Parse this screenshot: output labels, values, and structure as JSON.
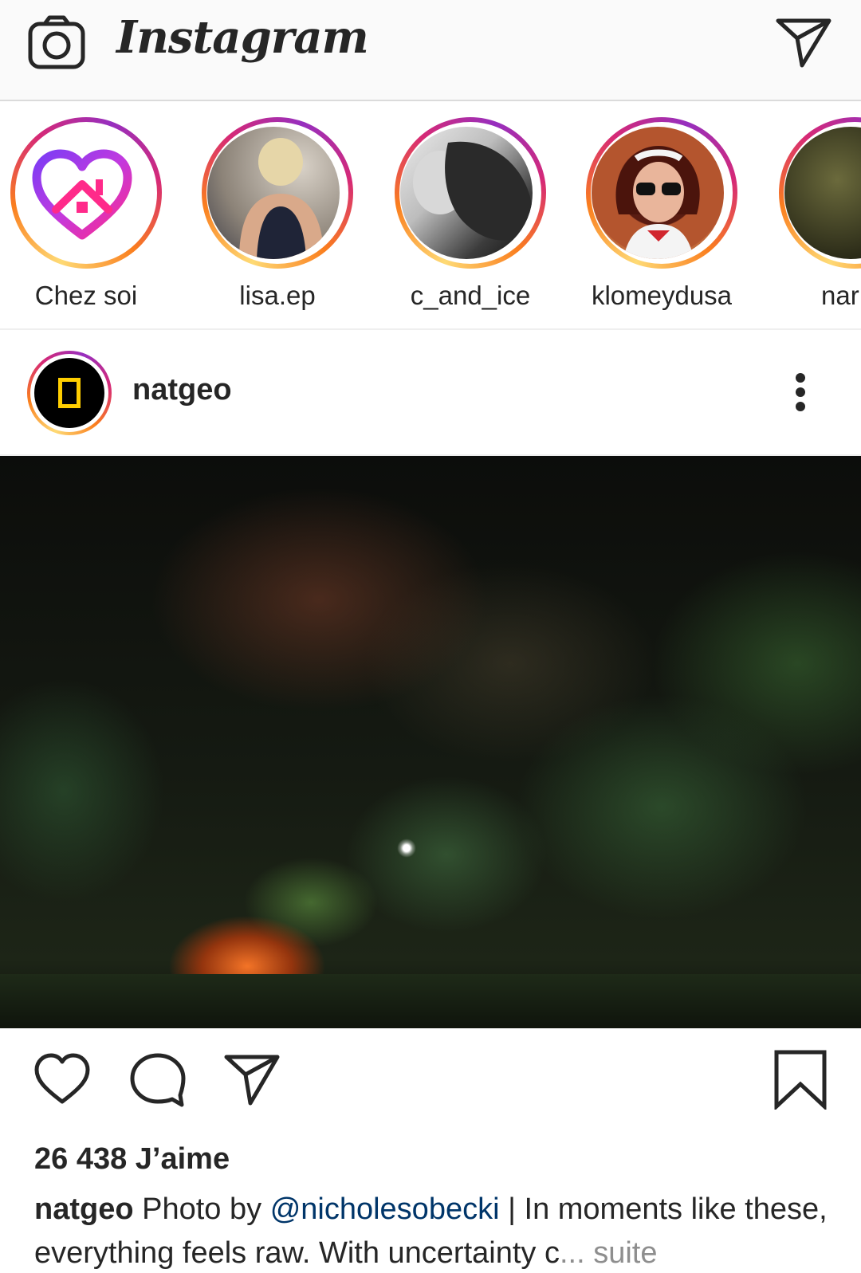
{
  "app": {
    "title": "Instagram"
  },
  "colors": {
    "link": "#003569",
    "muted": "#8e8e8e",
    "story_ring": [
      "#feda75",
      "#fa7e1e",
      "#d62976",
      "#962fbf"
    ],
    "natgeo_yellow": "#ffce00"
  },
  "header": {
    "camera_icon": "camera-icon",
    "direct_icon": "paper-plane-icon"
  },
  "stories": [
    {
      "label": "Chez soi",
      "icon": "heart-home-icon"
    },
    {
      "label": "lisa.ep"
    },
    {
      "label": "c_and_ice"
    },
    {
      "label": "klomeydusa"
    },
    {
      "label": "nar"
    }
  ],
  "post": {
    "username": "natgeo",
    "more_icon": "more-vertical-icon",
    "likes": "26 438 J’aime",
    "caption": {
      "username": "natgeo",
      "text_before": " Photo by ",
      "mention": "@nicholesobecki",
      "text_after": " | In moments like these, everything feels raw. With uncertainty c",
      "ellipsis": "...",
      "more": "suite"
    },
    "actions": {
      "like_icon": "heart-icon",
      "comment_icon": "comment-icon",
      "share_icon": "paper-plane-icon",
      "save_icon": "bookmark-icon"
    }
  }
}
